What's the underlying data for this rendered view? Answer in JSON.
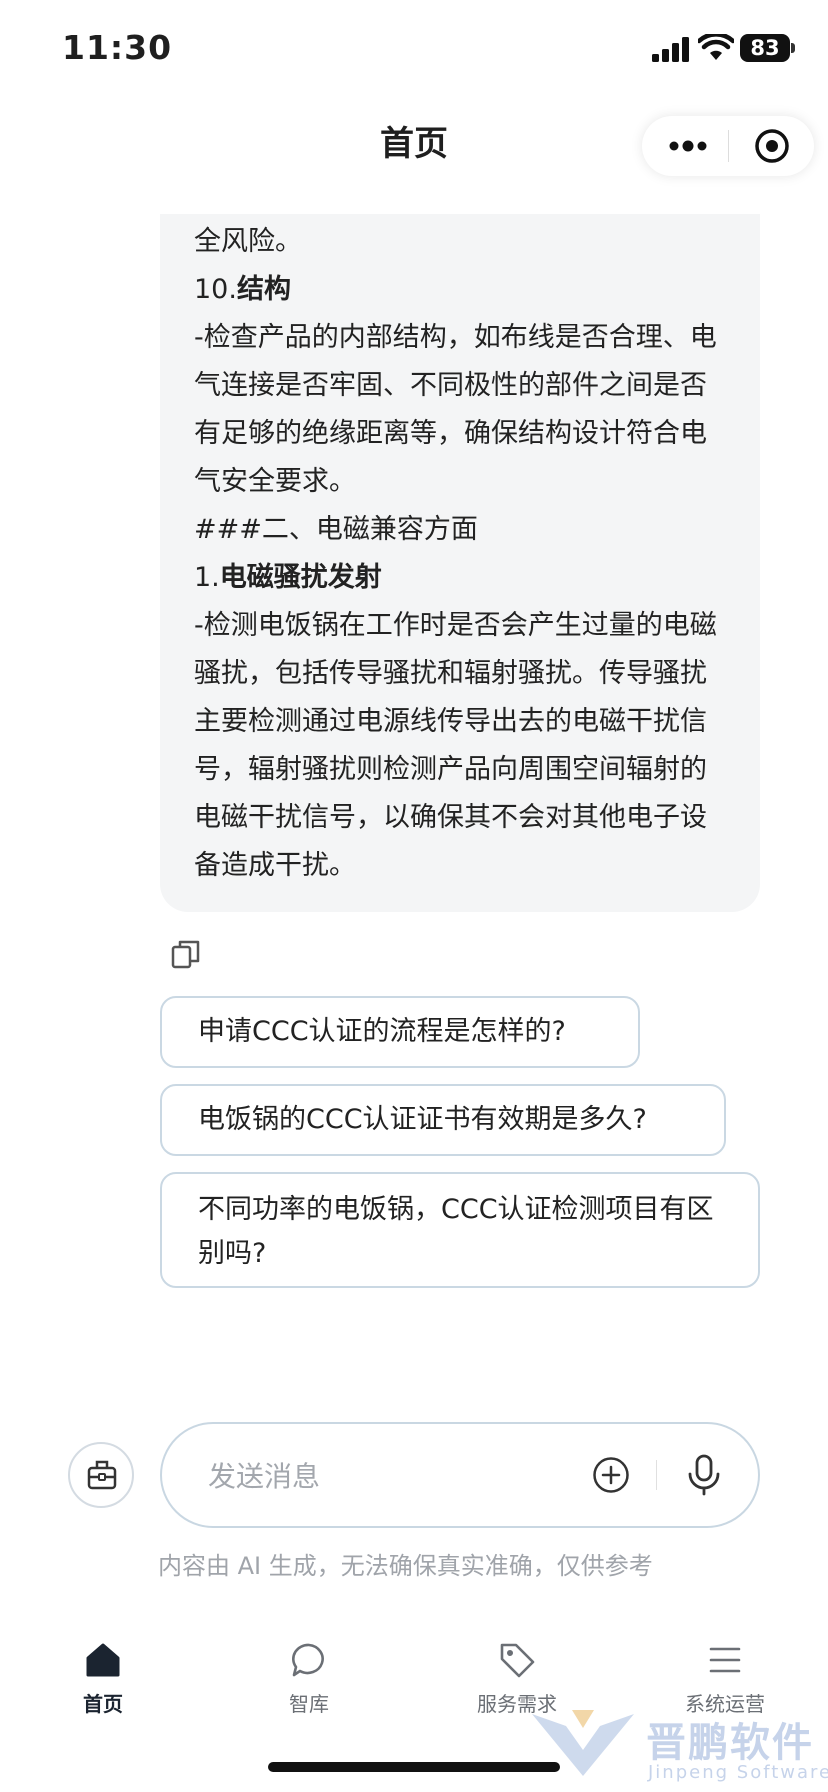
{
  "status_bar": {
    "time": "11:30",
    "battery": "83"
  },
  "header": {
    "title": "首页"
  },
  "answer": {
    "line1": "全风险。",
    "s10_num": "10.",
    "s10_title": "结构",
    "s10_text": "-检查产品的内部结构，如布线是否合理、电气连接是否牢固、不同极性的部件之间是否有足够的绝缘距离等，确保结构设计符合电气安全要求。",
    "section2": "###二、电磁兼容方面",
    "s1_num": "1.",
    "s1_title": "电磁骚扰发射",
    "s1_text": "-检测电饭锅在工作时是否会产生过量的电磁骚扰，包括传导骚扰和辐射骚扰。传导骚扰主要检测通过电源线传导出去的电磁干扰信号，辐射骚扰则检测产品向周围空间辐射的电磁干扰信号，以确保其不会对其他电子设备造成干扰。"
  },
  "suggestions": [
    "申请CCC认证的流程是怎样的?",
    "电饭锅的CCC认证证书有效期是多久?",
    "不同功率的电饭锅，CCC认证检测项目有区别吗?"
  ],
  "input": {
    "placeholder": "发送消息"
  },
  "disclaimer": "内容由 AI 生成，无法确保真实准确，仅供参考",
  "tabs": [
    {
      "label": "首页",
      "icon": "home-icon",
      "active": true
    },
    {
      "label": "智库",
      "icon": "chat-bubble-icon",
      "active": false
    },
    {
      "label": "服务需求",
      "icon": "tag-icon",
      "active": false
    },
    {
      "label": "系统运营",
      "icon": "menu-icon",
      "active": false
    }
  ],
  "watermark": {
    "cn": "晋鹏软件",
    "en": "Jinpeng Software"
  },
  "colors": {
    "accent": "#1b2430",
    "border": "#c9d7e2",
    "bubble": "#f4f5f6",
    "muted": "#a0a4aa"
  }
}
